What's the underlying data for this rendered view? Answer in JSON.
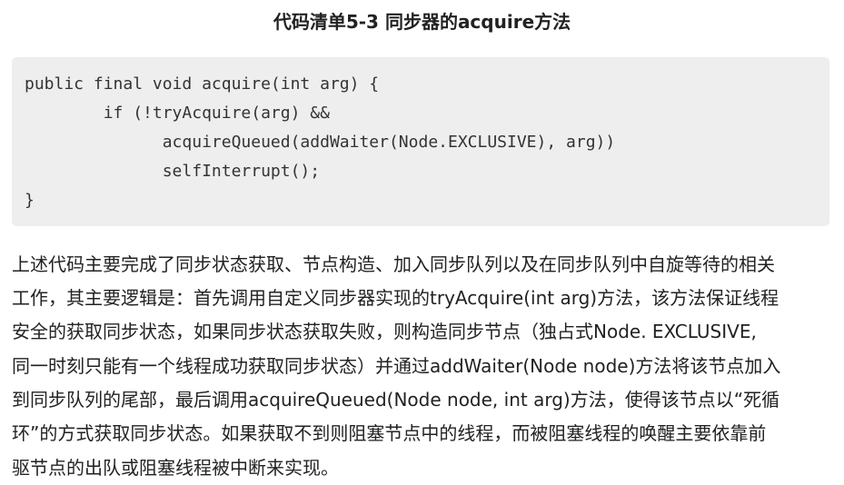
{
  "listing": {
    "title": "代码清单5-3 同步器的acquire方法"
  },
  "code": {
    "lines": [
      "public final void acquire(int arg) {",
      "        if (!tryAcquire(arg) &&",
      "              acquireQueued(addWaiter(Node.EXCLUSIVE), arg))",
      "              selfInterrupt();",
      "}"
    ]
  },
  "paragraph": {
    "lines": [
      "上述代码主要完成了同步状态获取、节点构造、加入同步队列以及在同步队列中自旋等待的相关",
      "工作，其主要逻辑是：首先调用自定义同步器实现的tryAcquire(int arg)方法，该方法保证线程",
      "安全的获取同步状态，如果同步状态获取失败，则构造同步节点（独占式Node. EXCLUSIVE,",
      "同一时刻只能有一个线程成功获取同步状态）并通过addWaiter(Node node)方法将该节点加入",
      "到同步队列的尾部，最后调用acquireQueued(Node node, int arg)方法，使得该节点以“死循",
      "环”的方式获取同步状态。如果获取不到则阻塞节点中的线程，而被阻塞线程的唤醒主要依靠前",
      "驱节点的出队或阻塞线程被中断来实现。"
    ]
  }
}
